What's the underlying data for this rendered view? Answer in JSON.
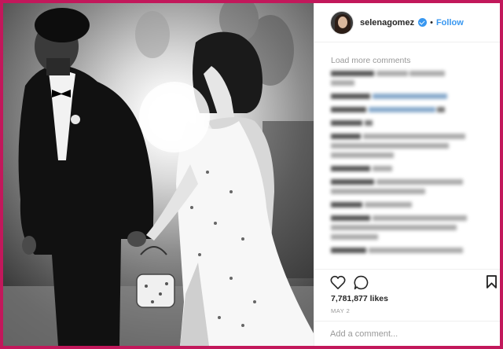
{
  "post": {
    "username": "selenagomez",
    "separator": "•",
    "follow_label": "Follow",
    "photo_alt": "Black and white photo of a couple holding hands",
    "load_more_label": "Load more comments",
    "likes": "7,781,877 likes",
    "date": "MAY 2",
    "comment_placeholder": "Add a comment..."
  },
  "comments": [
    {
      "user": "",
      "text": ""
    },
    {
      "user": "",
      "text": ""
    },
    {
      "user": "",
      "text": ""
    },
    {
      "user": "",
      "text": ""
    },
    {
      "user": "",
      "text": ""
    },
    {
      "user": "",
      "text": ""
    },
    {
      "user": "",
      "text": ""
    },
    {
      "user": "",
      "text": ""
    },
    {
      "user": "",
      "text": ""
    },
    {
      "user": "",
      "text": ""
    },
    {
      "user": "",
      "text": ""
    }
  ],
  "icons": {
    "verified": "verified-badge-icon",
    "like": "heart-icon",
    "comment": "comment-bubble-icon",
    "save": "bookmark-icon"
  },
  "colors": {
    "border_frame": "#c2185b",
    "link_blue": "#3897f0",
    "muted_text": "#999999",
    "text": "#262626"
  }
}
